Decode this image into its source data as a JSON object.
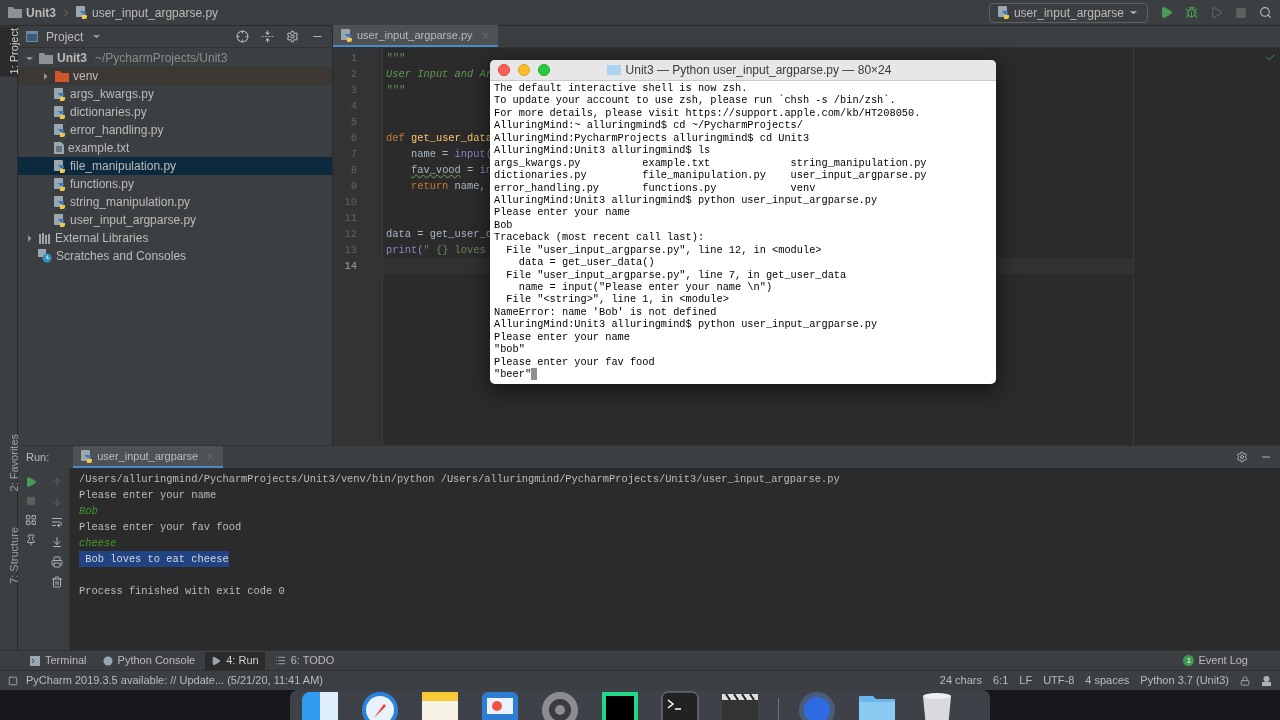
{
  "breadcrumb": [
    "Unit3",
    "user_input_argparse.py"
  ],
  "run_config": "user_input_argparse",
  "left_strip": {
    "top": [
      {
        "label": "1: Project",
        "selected": true
      }
    ],
    "bottom": [
      {
        "label": "2: Favorites",
        "selected": false
      },
      {
        "label": "7: Structure",
        "selected": false
      }
    ]
  },
  "project_panel": {
    "title": "Project",
    "tree": [
      {
        "name": "Unit3",
        "path": "~/PycharmProjects/Unit3",
        "kind": "folder",
        "expanded": true,
        "selected": false,
        "children": [
          {
            "name": "venv",
            "kind": "excluded_folder",
            "expanded": false,
            "selected": false
          },
          {
            "name": "args_kwargs.py",
            "kind": "python",
            "selected": false
          },
          {
            "name": "dictionaries.py",
            "kind": "python",
            "selected": false
          },
          {
            "name": "error_handling.py",
            "kind": "python",
            "selected": false
          },
          {
            "name": "example.txt",
            "kind": "text",
            "selected": false
          },
          {
            "name": "file_manipulation.py",
            "kind": "python",
            "selected": true
          },
          {
            "name": "functions.py",
            "kind": "python",
            "selected": false
          },
          {
            "name": "string_manipulation.py",
            "kind": "python",
            "selected": false
          },
          {
            "name": "user_input_argparse.py",
            "kind": "python",
            "selected": false
          }
        ]
      },
      {
        "name": "External Libraries",
        "kind": "libraries",
        "expanded": false,
        "selected": false
      },
      {
        "name": "Scratches and Consoles",
        "kind": "scratches",
        "selected": false
      }
    ]
  },
  "editor": {
    "tab": "user_input_argparse.py",
    "lines": [
      {
        "number": "1",
        "current": false,
        "tokens": [
          {
            "text": "\"\"\"",
            "kind": "docstring"
          }
        ]
      },
      {
        "number": "2",
        "current": false,
        "tokens": [
          {
            "text": "User Input and Ar",
            "kind": "docstring"
          }
        ]
      },
      {
        "number": "3",
        "current": false,
        "tokens": [
          {
            "text": "\"\"\"",
            "kind": "docstring"
          }
        ]
      },
      {
        "number": "4",
        "current": false
      },
      {
        "number": "5",
        "current": false
      },
      {
        "number": "6",
        "current": false,
        "tokens": [
          {
            "text": "def ",
            "kind": "keyword"
          },
          {
            "text": "get_user_data",
            "kind": "function"
          }
        ]
      },
      {
        "number": "7",
        "current": false,
        "tokens": [
          {
            "text": "    name = ",
            "kind": "plain"
          },
          {
            "text": "input(",
            "kind": "builtin"
          }
        ]
      },
      {
        "number": "8",
        "current": false,
        "tokens": [
          {
            "text": "    fav_vood",
            "kind": "warning"
          },
          {
            "text": " = ",
            "kind": "plain"
          },
          {
            "text": "in",
            "kind": "builtin"
          }
        ]
      },
      {
        "number": "9",
        "current": false,
        "tokens": [
          {
            "text": "    return ",
            "kind": "keyword"
          },
          {
            "text": "name,",
            "kind": "plain"
          }
        ]
      },
      {
        "number": "10",
        "current": false
      },
      {
        "number": "11",
        "current": false
      },
      {
        "number": "12",
        "current": false,
        "tokens": [
          {
            "text": "data = get_user_c",
            "kind": "plain"
          }
        ]
      },
      {
        "number": "13",
        "current": false,
        "tokens": [
          {
            "text": "print(",
            "kind": "builtin"
          },
          {
            "text": "\" {} loves",
            "kind": "string"
          }
        ]
      },
      {
        "number": "14",
        "current": true
      }
    ]
  },
  "terminal": {
    "title": "Unit3 — Python user_input_argparse.py — 80×24",
    "cursor": true,
    "lines": [
      "The default interactive shell is now zsh.",
      "To update your account to use zsh, please run `chsh -s /bin/zsh`.",
      "For more details, please visit https://support.apple.com/kb/HT208050.",
      "AlluringMind:~ alluringmind$ cd ~/PycharmProjects/",
      "AlluringMind:PycharmProjects alluringmind$ cd Unit3",
      "AlluringMind:Unit3 alluringmind$ ls",
      "args_kwargs.py          example.txt             string_manipulation.py",
      "dictionaries.py         file_manipulation.py    user_input_argparse.py",
      "error_handling.py       functions.py            venv",
      "AlluringMind:Unit3 alluringmind$ python user_input_argparse.py",
      "Please enter your name",
      "Bob",
      "Traceback (most recent call last):",
      "  File \"user_input_argparse.py\", line 12, in <module>",
      "    data = get_user_data()",
      "  File \"user_input_argparse.py\", line 7, in get_user_data",
      "    name = input(\"Please enter your name \\n\")",
      "  File \"<string>\", line 1, in <module>",
      "NameError: name 'Bob' is not defined",
      "AlluringMind:Unit3 alluringmind$ python user_input_argparse.py",
      "Please enter your name",
      "\"bob\"",
      "Please enter your fav food",
      "\"beer\""
    ]
  },
  "run_panel": {
    "label": "Run:",
    "tab": "user_input_argparse",
    "lines": [
      {
        "text": "/Users/alluringmind/PycharmProjects/Unit3/venv/bin/python /Users/alluringmind/PycharmProjects/Unit3/user_input_argparse.py",
        "kind": "output"
      },
      {
        "text": "Please enter your name",
        "kind": "output"
      },
      {
        "text": "Bob",
        "kind": "input"
      },
      {
        "text": "Please enter your fav food",
        "kind": "output"
      },
      {
        "text": "cheese",
        "kind": "input"
      },
      {
        "text": " Bob loves to eat cheese",
        "kind": "highlighted"
      },
      {
        "text": "Process finished with exit code 0",
        "kind": "exit"
      }
    ]
  },
  "tool_tabs": [
    {
      "label": "Terminal",
      "kind": "terminal",
      "selected": false
    },
    {
      "label": "Python Console",
      "kind": "console",
      "selected": false
    },
    {
      "label": "4: Run",
      "kind": "run",
      "selected": true
    },
    {
      "label": "6: TODO",
      "kind": "todo",
      "selected": false
    }
  ],
  "event_log": {
    "count": "1",
    "label": "Event Log"
  },
  "status_bar": {
    "message": "PyCharm 2019.3.5 available: // Update... (5/21/20, 11:41 AM)",
    "items": [
      "24 chars",
      "6:1",
      "LF",
      "UTF-8",
      "4 spaces",
      "Python 3.7 (Unit3)"
    ]
  }
}
